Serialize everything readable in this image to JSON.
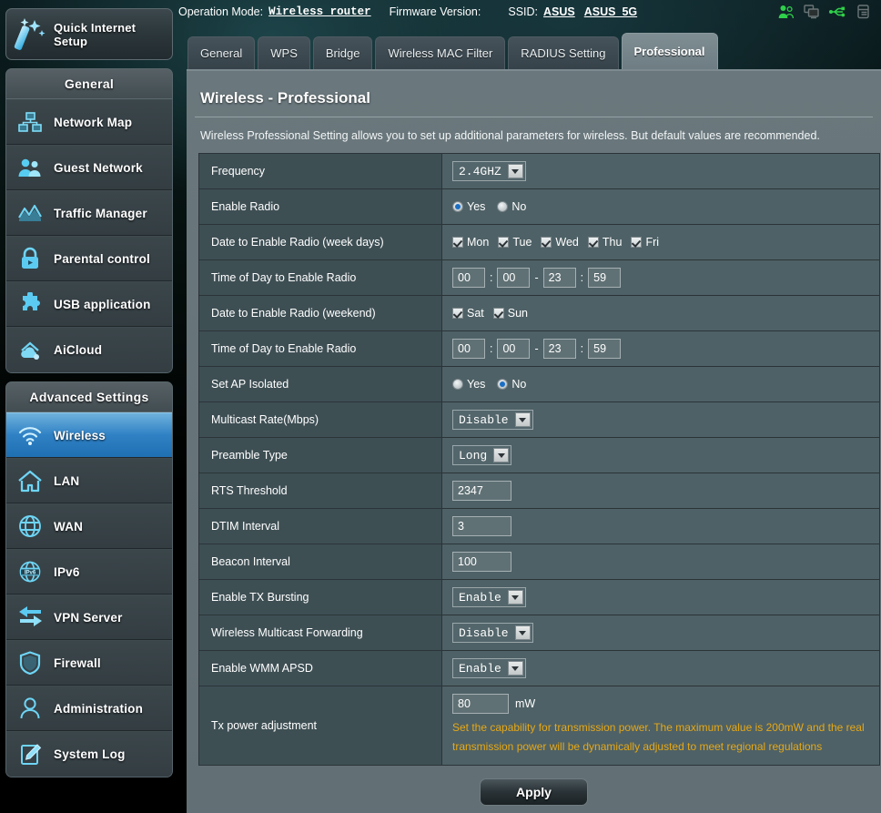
{
  "topbar": {
    "operation_mode_label": "Operation Mode:",
    "operation_mode_value": "Wireless router",
    "firmware_label": "Firmware Version:",
    "firmware_value": "",
    "ssid_label": "SSID:",
    "ssid_1": "ASUS",
    "ssid_2": "ASUS_5G",
    "icons": [
      {
        "name": "clients-icon",
        "color": "#2fd04a"
      },
      {
        "name": "devices-icon",
        "color": "#6b7577"
      },
      {
        "name": "usb-icon",
        "color": "#2fd04a"
      },
      {
        "name": "printer-icon",
        "color": "#6b7577"
      }
    ]
  },
  "sidebar": {
    "quick_setup": {
      "label": "Quick Internet Setup",
      "icon": "magic-wand-icon"
    },
    "general_header": "General",
    "general_items": [
      {
        "label": "Network Map",
        "icon": "network-map-icon"
      },
      {
        "label": "Guest Network",
        "icon": "guest-network-icon"
      },
      {
        "label": "Traffic Manager",
        "icon": "traffic-manager-icon"
      },
      {
        "label": "Parental control",
        "icon": "lock-icon"
      },
      {
        "label": "USB application",
        "icon": "puzzle-icon"
      },
      {
        "label": "AiCloud",
        "icon": "cloud-icon"
      }
    ],
    "advanced_header": "Advanced Settings",
    "advanced_items": [
      {
        "label": "Wireless",
        "icon": "wifi-icon",
        "active": true
      },
      {
        "label": "LAN",
        "icon": "home-icon",
        "active": false
      },
      {
        "label": "WAN",
        "icon": "globe-icon",
        "active": false
      },
      {
        "label": "IPv6",
        "icon": "ipv6-globe-icon",
        "active": false
      },
      {
        "label": "VPN Server",
        "icon": "vpn-arrows-icon",
        "active": false
      },
      {
        "label": "Firewall",
        "icon": "shield-icon",
        "active": false
      },
      {
        "label": "Administration",
        "icon": "user-icon",
        "active": false
      },
      {
        "label": "System Log",
        "icon": "log-pencil-icon",
        "active": false
      }
    ]
  },
  "tabs": [
    {
      "label": "General",
      "active": false
    },
    {
      "label": "WPS",
      "active": false
    },
    {
      "label": "Bridge",
      "active": false
    },
    {
      "label": "Wireless MAC Filter",
      "active": false
    },
    {
      "label": "RADIUS Setting",
      "active": false
    },
    {
      "label": "Professional",
      "active": true
    }
  ],
  "page": {
    "title": "Wireless - Professional",
    "description": "Wireless Professional Setting allows you to set up additional parameters for wireless. But default values are recommended."
  },
  "form": {
    "frequency": {
      "label": "Frequency",
      "value": "2.4GHZ"
    },
    "enable_radio": {
      "label": "Enable Radio",
      "yes_label": "Yes",
      "no_label": "No",
      "selected": "Yes"
    },
    "week_days": {
      "label": "Date to Enable Radio (week days)",
      "days": [
        {
          "label": "Mon",
          "checked": true
        },
        {
          "label": "Tue",
          "checked": true
        },
        {
          "label": "Wed",
          "checked": true
        },
        {
          "label": "Thu",
          "checked": true
        },
        {
          "label": "Fri",
          "checked": true
        }
      ]
    },
    "time_weekday": {
      "label": "Time of Day to Enable Radio",
      "start_hour": "00",
      "start_min": "00",
      "end_hour": "23",
      "end_min": "59",
      "colon": ":",
      "dash": "-"
    },
    "weekend": {
      "label": "Date to Enable Radio (weekend)",
      "days": [
        {
          "label": "Sat",
          "checked": true
        },
        {
          "label": "Sun",
          "checked": true
        }
      ]
    },
    "time_weekend": {
      "label": "Time of Day to Enable Radio",
      "start_hour": "00",
      "start_min": "00",
      "end_hour": "23",
      "end_min": "59",
      "colon": ":",
      "dash": "-"
    },
    "ap_isolated": {
      "label": "Set AP Isolated",
      "yes_label": "Yes",
      "no_label": "No",
      "selected": "No"
    },
    "multicast_rate": {
      "label": "Multicast Rate(Mbps)",
      "value": "Disable"
    },
    "preamble_type": {
      "label": "Preamble Type",
      "value": "Long"
    },
    "rts_threshold": {
      "label": "RTS Threshold",
      "value": "2347"
    },
    "dtim_interval": {
      "label": "DTIM Interval",
      "value": "3"
    },
    "beacon_interval": {
      "label": "Beacon Interval",
      "value": "100"
    },
    "tx_bursting": {
      "label": "Enable TX Bursting",
      "value": "Enable"
    },
    "multicast_forwarding": {
      "label": "Wireless Multicast Forwarding",
      "value": "Disable"
    },
    "wmm_apsd": {
      "label": "Enable WMM APSD",
      "value": "Enable"
    },
    "tx_power": {
      "label": "Tx power adjustment",
      "value": "80",
      "unit": "mW",
      "note": "Set the capability for transmission power. The maximum value is 200mW and the real transmission power will be dynamically adjusted to meet regional regulations",
      "note_color": "#e6a817"
    }
  },
  "actions": {
    "apply_label": "Apply"
  }
}
